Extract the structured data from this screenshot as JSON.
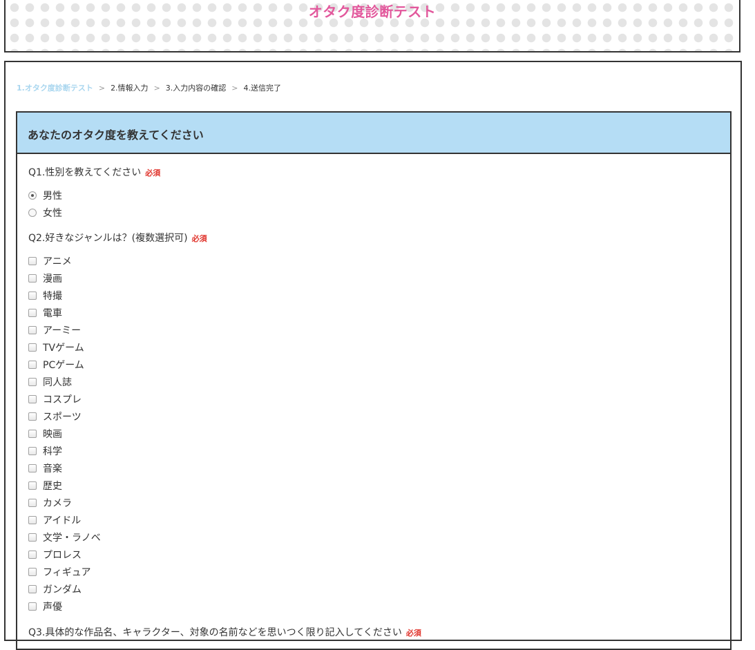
{
  "header": {
    "title": "オタク度診断テスト"
  },
  "steps": [
    {
      "label": "1.オタク度診断テスト",
      "active": true
    },
    {
      "label": "2.情報入力",
      "active": false
    },
    {
      "label": "3.入力内容の確認",
      "active": false
    },
    {
      "label": "4.送信完了",
      "active": false
    }
  ],
  "step_separator": ">",
  "panel": {
    "title": "あなたのオタク度を教えてください"
  },
  "required_label": "必須",
  "q1": {
    "label": "Q1.性別を教えてください",
    "options": [
      {
        "label": "男性",
        "checked": true
      },
      {
        "label": "女性",
        "checked": false
      }
    ]
  },
  "q2": {
    "label": "Q2.好きなジャンルは？(複数選択可)",
    "options": [
      {
        "label": "アニメ",
        "checked": false
      },
      {
        "label": "漫画",
        "checked": false
      },
      {
        "label": "特撮",
        "checked": false
      },
      {
        "label": "電車",
        "checked": false
      },
      {
        "label": "アーミー",
        "checked": false
      },
      {
        "label": "TVゲーム",
        "checked": false
      },
      {
        "label": "PCゲーム",
        "checked": false
      },
      {
        "label": "同人誌",
        "checked": false
      },
      {
        "label": "コスプレ",
        "checked": false
      },
      {
        "label": "スポーツ",
        "checked": false
      },
      {
        "label": "映画",
        "checked": false
      },
      {
        "label": "科学",
        "checked": false
      },
      {
        "label": "音楽",
        "checked": false
      },
      {
        "label": "歴史",
        "checked": false
      },
      {
        "label": "カメラ",
        "checked": false
      },
      {
        "label": "アイドル",
        "checked": false
      },
      {
        "label": "文学・ラノベ",
        "checked": false
      },
      {
        "label": "プロレス",
        "checked": false
      },
      {
        "label": "フィギュア",
        "checked": false
      },
      {
        "label": "ガンダム",
        "checked": false
      },
      {
        "label": "声優",
        "checked": false
      }
    ]
  },
  "q3": {
    "label": "Q3.具体的な作品名、キャラクター、対象の名前などを思いつく限り記入してください"
  },
  "colors": {
    "title_pink": "#e2589c",
    "active_step": "#a9d6ef",
    "panel_header_bg": "#b5ddf5",
    "required_red": "#e0332b"
  }
}
